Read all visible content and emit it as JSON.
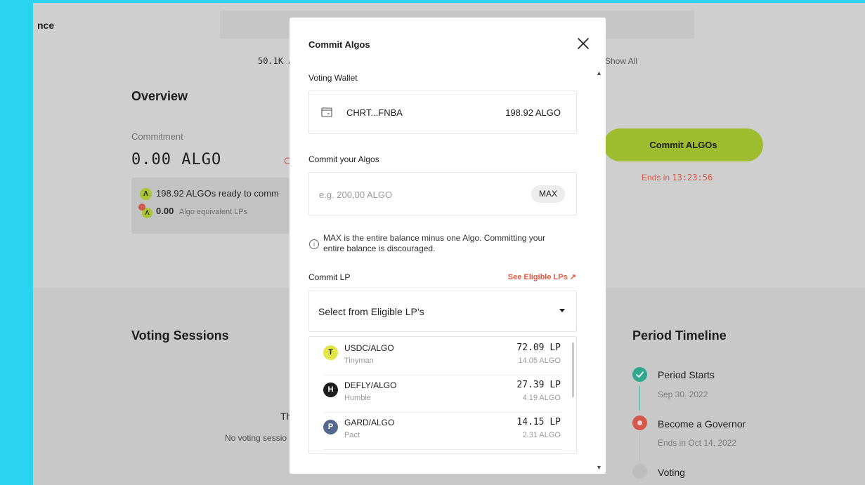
{
  "background": {
    "brand": "nce",
    "stats": {
      "supply": "50.1K",
      "supply_suffix": "A",
      "show_all": "Show All"
    },
    "overview": {
      "title": "Overview",
      "commitment_label": "Commitment",
      "commitment_value": "0.00 ALGO",
      "partial_red": "C",
      "ready_text": "198.92 ALGOs ready to comm",
      "lp_amount": "0.00",
      "lp_text": "Algo equivalent LPs",
      "commit_button": "Commit ALGOs",
      "ends_prefix": "Ends in",
      "ends_time": "13:23:56"
    },
    "voting": {
      "title": "Voting Sessions",
      "partial_heading": "Th",
      "empty_text": "No voting sessio"
    },
    "timeline": {
      "title": "Period Timeline",
      "steps": [
        {
          "label": "Period Starts",
          "sub": "Sep 30, 2022",
          "status": "done",
          "color": "#2fa88f"
        },
        {
          "label": "Become a Governor",
          "sub": "Ends in Oct 14, 2022",
          "status": "active",
          "color": "#d2584a"
        },
        {
          "label": "Voting",
          "sub": "",
          "status": "pending",
          "color": "#bdbdbd"
        }
      ]
    },
    "colors": {
      "accent": "#9ebc2e",
      "danger": "#d2584a",
      "teal": "#2fa88f",
      "frame": "#2ad3ef"
    }
  },
  "modal": {
    "title": "Commit Algos",
    "close_icon": "close-icon",
    "wallet_label": "Voting Wallet",
    "wallet_address": "CHRT...FNBA",
    "wallet_balance": "198.92 ALGO",
    "commit_label": "Commit your Algos",
    "amount_placeholder": "e.g. 200,00 ALGO",
    "amount_value": "",
    "max_label": "MAX",
    "info_text": "MAX is the entire balance minus one Algo. Committing your entire balance is discouraged.",
    "lp_label": "Commit LP",
    "eligible_link": "See Eligible LPs",
    "eligible_arrow": "↗",
    "select_label": "Select from Eligible LP’s",
    "lps": [
      {
        "pair": "USDC/ALGO",
        "source": "Tinyman",
        "amount": "72.09 LP",
        "equivalent": "14.05 ALGO",
        "logo_color": "#e3e64a",
        "logo_text": "T"
      },
      {
        "pair": "DEFLY/ALGO",
        "source": "Humble",
        "amount": "27.39 LP",
        "equivalent": "4.19 ALGO",
        "logo_color": "#1e1e1e",
        "logo_text": "H"
      },
      {
        "pair": "GARD/ALGO",
        "source": "Pact",
        "amount": "14.15 LP",
        "equivalent": "2.31 ALGO",
        "logo_color": "#55698f",
        "logo_text": "P"
      }
    ]
  }
}
